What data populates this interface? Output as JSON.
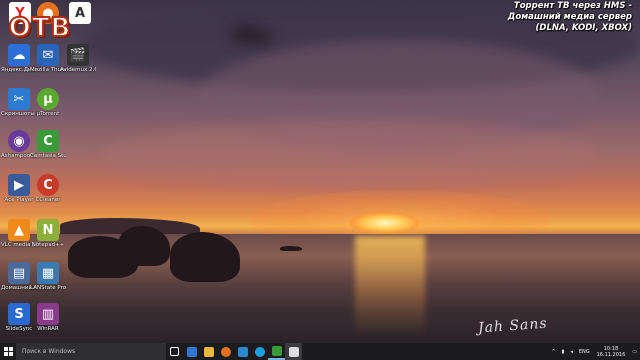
{
  "overlay": {
    "brand": "ОТВ",
    "title_line1": "Торрент ТВ через HMS -",
    "title_line2": "Домашний медиа сервер",
    "title_line3": "(DLNA, KODI, XBOX)"
  },
  "desktop_icons": [
    {
      "label": "Яндекс.Диск",
      "color": "#2b6fd6",
      "glyph": "☁"
    },
    {
      "label": "Mozilla Thunderbird",
      "color": "#2a64b8",
      "glyph": "✉"
    },
    {
      "label": "Avidemux 2.6 - 64bits",
      "color": "#333333",
      "glyph": "🎬"
    },
    {
      "label": "Скриншоты в Яндекс.Д...",
      "color": "#2d7bd0",
      "glyph": "✂"
    },
    {
      "label": "µTorrent",
      "color": "#5aa832",
      "glyph": "µ"
    },
    {
      "label": "Ashampoo Snap 9",
      "color": "#6a3a9a",
      "glyph": "◉"
    },
    {
      "label": "Camtasia Studio 8",
      "color": "#3a9a3a",
      "glyph": "C"
    },
    {
      "label": "Ace Player",
      "color": "#3a5a9a",
      "glyph": "▶"
    },
    {
      "label": "CCleaner",
      "color": "#c83a2a",
      "glyph": "C"
    },
    {
      "label": "VLC media player",
      "color": "#f08a1a",
      "glyph": "▲"
    },
    {
      "label": "Notepad++",
      "color": "#8ab03a",
      "glyph": "N"
    },
    {
      "label": "Домашний медиа-сер...",
      "color": "#4a6a9a",
      "glyph": "▤"
    },
    {
      "label": "LANState Pro",
      "color": "#3a7ab0",
      "glyph": "▦"
    },
    {
      "label": "SlideSync",
      "color": "#2a6ad0",
      "glyph": "S"
    },
    {
      "label": "WinRAR",
      "color": "#8a3a8a",
      "glyph": "▥"
    }
  ],
  "top_icons": [
    {
      "name": "yandex-browser-icon",
      "color": "#ffffff",
      "glyph": "Y"
    },
    {
      "name": "firefox-icon",
      "color": "#e8701a",
      "glyph": "●"
    },
    {
      "name": "acrobat-icon",
      "color": "#ffffff",
      "glyph": "A"
    }
  ],
  "taskbar": {
    "search_placeholder": "Поиск в Windows",
    "lang": "ENG",
    "time": "10:18",
    "date": "16.11.2016",
    "pinned": [
      {
        "name": "task-view-icon",
        "color": "#ffffff"
      },
      {
        "name": "edge-icon",
        "color": "#2a7ad0"
      },
      {
        "name": "file-explorer-icon",
        "color": "#e8b83a"
      },
      {
        "name": "firefox-taskbar-icon",
        "color": "#e8701a"
      },
      {
        "name": "store-icon",
        "color": "#2a8ad0"
      },
      {
        "name": "skype-icon",
        "color": "#1aa0e0"
      },
      {
        "name": "camtasia-taskbar-icon",
        "color": "#3a9a3a"
      },
      {
        "name": "app-c-icon",
        "color": "#dddddd"
      }
    ]
  },
  "signature": "Jah Sans"
}
